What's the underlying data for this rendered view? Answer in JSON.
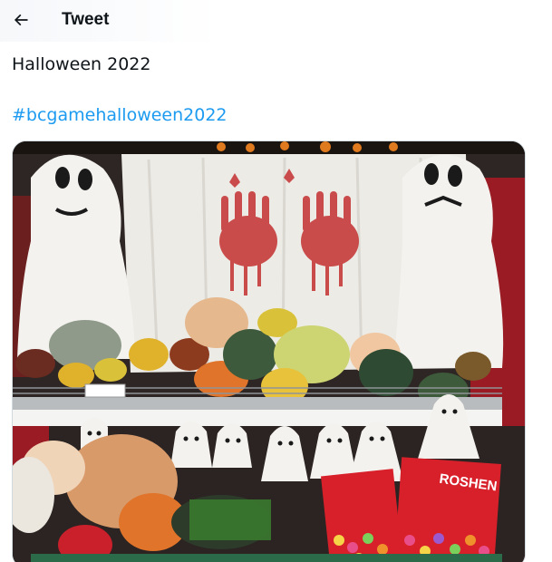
{
  "header": {
    "title": "Tweet",
    "back_icon": "arrow-left-icon"
  },
  "tweet": {
    "text": "Halloween 2022",
    "hashtag": "#bcgamehalloween2022"
  },
  "media": {
    "bag_label": "ROSHEN",
    "colors": {
      "hashtag": "#1d9bf0",
      "ghost": "#f1f0ec",
      "pumpkin": "#e0742a",
      "candy_bag": "#d8202b"
    }
  }
}
